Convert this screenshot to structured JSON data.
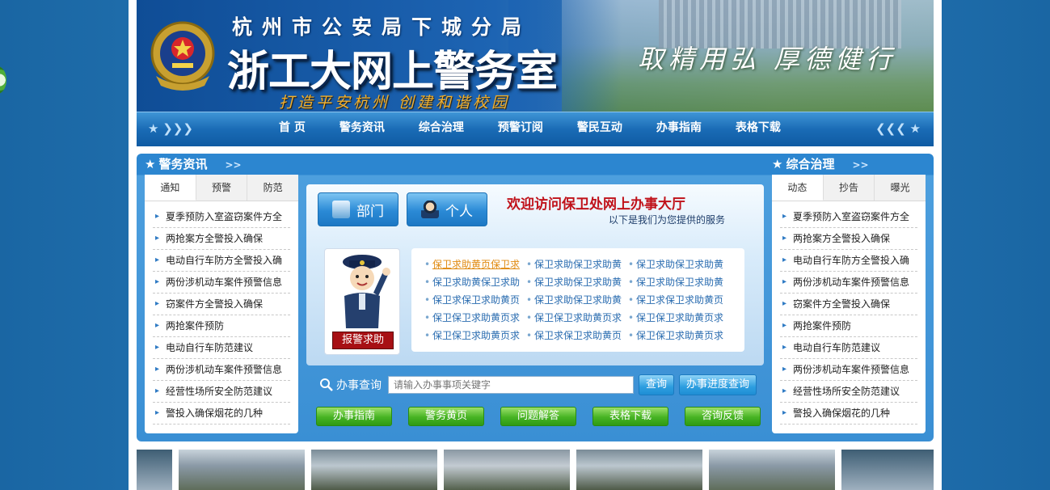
{
  "header": {
    "org_name": "杭州市公安局下城分局",
    "site_title": "浙工大网上警务室",
    "slogan": "打造平安杭州 创建和谐校园",
    "motto": "取精用弘 厚德健行"
  },
  "nav": {
    "items": [
      "首 页",
      "警务资讯",
      "综合治理",
      "预警订阅",
      "警民互动",
      "办事指南",
      "表格下载"
    ]
  },
  "left_panel": {
    "title": "警务资讯",
    "tabs": [
      "通知",
      "预警",
      "防范"
    ],
    "active_tab": "通知",
    "news": [
      "夏季预防入室盗窃案件方全",
      "两抢案方全警投入确保",
      "电动自行车防方全警投入确",
      "两份涉机动车案件预警信息",
      "窃案件方全警投入确保",
      "两抢案件预防",
      "电动自行车防范建议",
      "两份涉机动车案件预警信息",
      "经营性场所安全防范建议",
      "警投入确保烟花的几种"
    ]
  },
  "right_panel": {
    "title": "综合治理",
    "tabs": [
      "动态",
      "抄告",
      "曝光"
    ],
    "active_tab": "动态",
    "news": [
      "夏季预防入室盗窃案件方全",
      "两抢案方全警投入确保",
      "电动自行车防方全警投入确",
      "两份涉机动车案件预警信息",
      "窃案件方全警投入确保",
      "两抢案件预防",
      "电动自行车防范建议",
      "两份涉机动车案件预警信息",
      "经营性场所安全防范建议",
      "警投入确保烟花的几种"
    ]
  },
  "center": {
    "dept_button": "部门",
    "person_button": "个人",
    "welcome": "欢迎访问保卫处网上办事大厅",
    "subtitle": "以下是我们为您提供的服务",
    "help_button": "报警求助",
    "links": [
      "保卫求助黄页保卫求",
      "保卫求助保卫求助黄",
      "保卫求助保卫求助黄",
      "保卫求助黄保卫求助",
      "保卫求助保卫求助黄",
      "保卫求助保卫求助黄",
      "保卫求保卫求助黄页",
      "保卫求助保卫求助黄",
      "保卫求保卫求助黄页",
      "保卫保卫求助黄页求",
      "保卫保卫求助黄页求",
      "保卫保卫求助黄页求",
      "保卫保卫求助黄页求",
      "保卫求保卫求助黄页",
      "保卫保卫求助黄页求"
    ]
  },
  "search": {
    "label": "办事查询",
    "placeholder": "请输入办事事项关键字",
    "button": "查询",
    "progress_button": "办事进度查询"
  },
  "quick_links": [
    "办事指南",
    "警务黄页",
    "问题解答",
    "表格下载",
    "咨询反馈"
  ],
  "colors": {
    "page_bg": "#1f6fae",
    "nav_bg": "#1a6bb5",
    "welcome_red": "#c0121a",
    "link_blue": "#2a6cb0",
    "green_button": "#46b323"
  }
}
